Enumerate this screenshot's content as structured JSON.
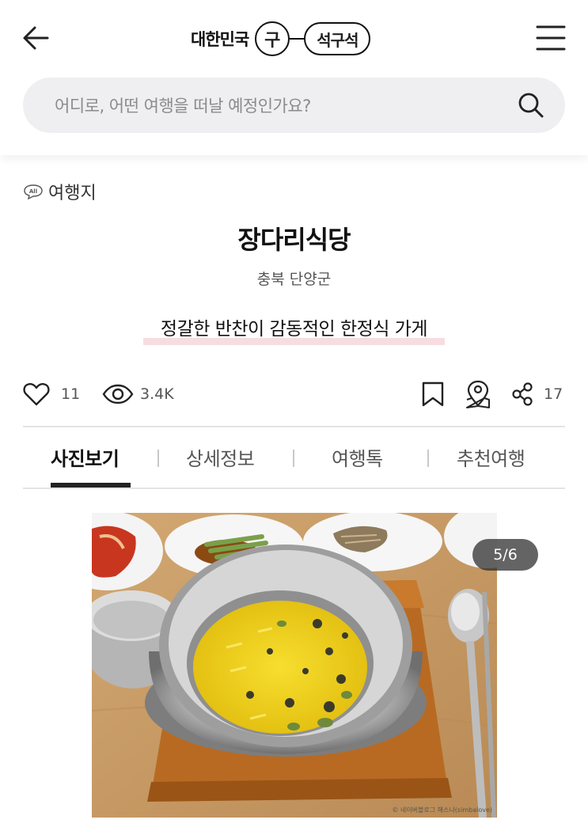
{
  "header": {
    "logo_prefix": "대한민국",
    "logo_circle": "구",
    "logo_pill": "석구석"
  },
  "search": {
    "placeholder": "어디로, 어떤 여행을 떠날 예정인가요?"
  },
  "category": {
    "icon_text": "All",
    "label": "여행지"
  },
  "place": {
    "title": "장다리식당",
    "location": "충북 단양군",
    "tagline": "정갈한 반찬이 감동적인 한정식 가게"
  },
  "stats": {
    "likes": "11",
    "views": "3.4K",
    "shares": "17"
  },
  "tabs": [
    {
      "label": "사진보기",
      "active": true
    },
    {
      "label": "상세정보",
      "active": false
    },
    {
      "label": "여행톡",
      "active": false
    },
    {
      "label": "추천여행",
      "active": false
    }
  ],
  "photo": {
    "counter": "5/6",
    "credit": "© 네이버블로그 해스나(simbalove)"
  },
  "colors": {
    "highlight": "#f7dde2",
    "search_bg": "#efeff1",
    "rice": "#f2d21e"
  }
}
